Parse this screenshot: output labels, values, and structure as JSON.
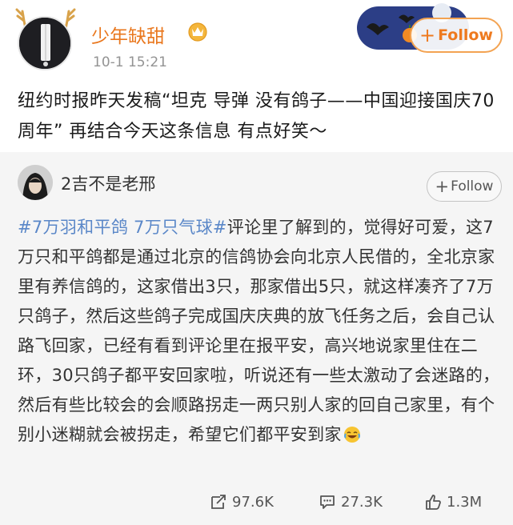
{
  "post": {
    "author": "少年缺甜",
    "timestamp": "10-1 15:21",
    "follow_label": "Follow",
    "text": "纽约时报昨天发稿“坦克 导弹 没有鸽子——中国迎接国庆70周年” 再结合今天这条信息 有点好笑～"
  },
  "repost": {
    "author": "2吉不是老邢",
    "follow_label": "Follow",
    "topic1": "#7万羽和平鸽 7万只气球#",
    "body": "评论里了解到的，觉得好可爱，这7万只和平鸽都是通过北京的信鸽协会向北京人民借的，全北京家里有养信鸽的，这家借出3只，那家借出5只，就这样凑齐了7万只鸽子，然后这些鸽子完成国庆庆典的放飞任务之后，会自己认路飞回家，已经有看到评论里在报平安，高兴地说家里住在二环，30只鸽子都平安回家啦，听说还有一些太激动了会迷路的，然后有些比较会的会顺路拐走一两只别人家的回自己家里，有个别小迷糊就会被拐走，希望它们都平安到家"
  },
  "stats": {
    "reposts": "97.6K",
    "comments": "27.3K",
    "likes": "1.3M"
  },
  "colors": {
    "username_orange": "#e9771d",
    "follow_orange": "#ee7a1f",
    "topic_blue": "#5a87c8",
    "repost_bg": "#f5f5f5"
  },
  "icons": {
    "repost": "share-icon",
    "comment": "comment-icon",
    "like": "thumbs-up-icon"
  }
}
